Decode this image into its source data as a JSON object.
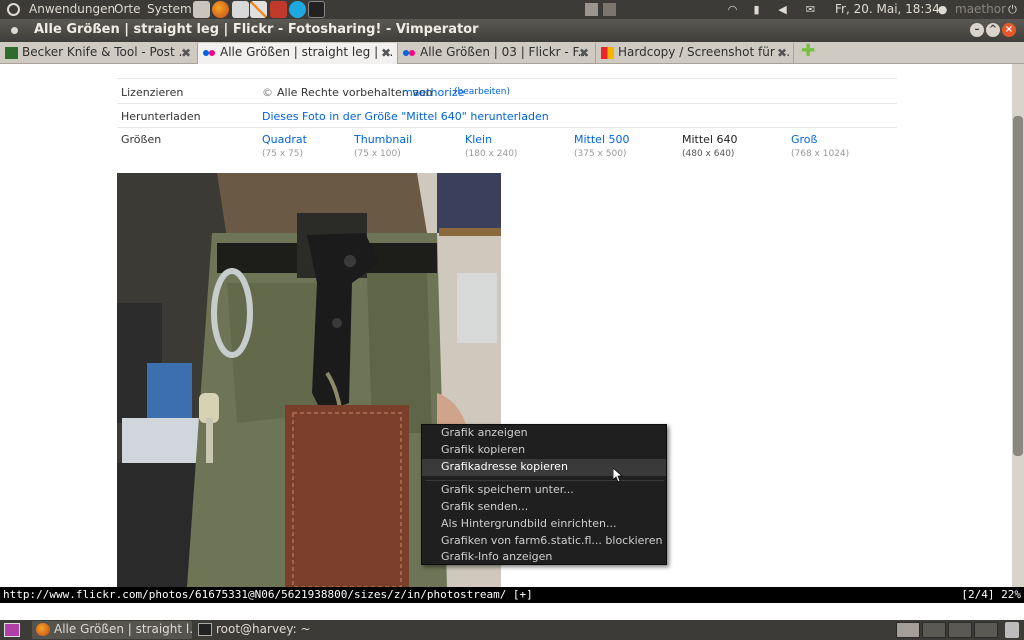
{
  "top_panel": {
    "menus": [
      "Anwendungen",
      "Orte",
      "System"
    ],
    "clock": "Fr, 20. Mai, 18:34",
    "user": "maethor"
  },
  "window": {
    "title": "Alle Größen | straight leg | Flickr - Fotosharing! - Vimperator"
  },
  "tabs": [
    {
      "label": "Becker Knife & Tool - Post ...",
      "active": false
    },
    {
      "label": "Alle Größen | straight leg | ...",
      "active": true
    },
    {
      "label": "Alle Größen | 03 | Flickr - F...",
      "active": false
    },
    {
      "label": "Hardcopy / Screenshot für ...",
      "active": false
    }
  ],
  "page": {
    "license_label": "Lizenzieren",
    "license_text": "Alle Rechte vorbehalten von",
    "license_owner": "maethorize",
    "license_edit": "(bearbeiten)",
    "download_label": "Herunterladen",
    "download_link": "Dieses Foto in der Größe \"Mittel 640\" herunterladen",
    "sizes_label": "Größen",
    "sizes": [
      {
        "name": "Quadrat",
        "dim": "(75 x 75)",
        "current": false
      },
      {
        "name": "Thumbnail",
        "dim": "(75 x 100)",
        "current": false
      },
      {
        "name": "Klein",
        "dim": "(180 x 240)",
        "current": false
      },
      {
        "name": "Mittel 500",
        "dim": "(375 x 500)",
        "current": false
      },
      {
        "name": "Mittel 640",
        "dim": "(480 x 640)",
        "current": true
      },
      {
        "name": "Groß",
        "dim": "(768 x 1024)",
        "current": false
      }
    ]
  },
  "context_menu": {
    "items": [
      "Grafik anzeigen",
      "Grafik kopieren",
      "Grafikadresse kopieren",
      "Grafik speichern unter...",
      "Grafik senden...",
      "Als Hintergrundbild einrichten...",
      "Grafiken von farm6.static.fl... blockieren",
      "Grafik-Info anzeigen"
    ],
    "highlighted_index": 2
  },
  "statusline": {
    "url": "http://www.flickr.com/photos/61675331@N06/5621938800/sizes/z/in/photostream/ [+]",
    "position": "[2/4] 22%"
  },
  "taskbar": {
    "tasks": [
      {
        "label": "Alle Größen | straight l...",
        "active": true
      },
      {
        "label": "root@harvey: ~",
        "active": false
      }
    ]
  }
}
